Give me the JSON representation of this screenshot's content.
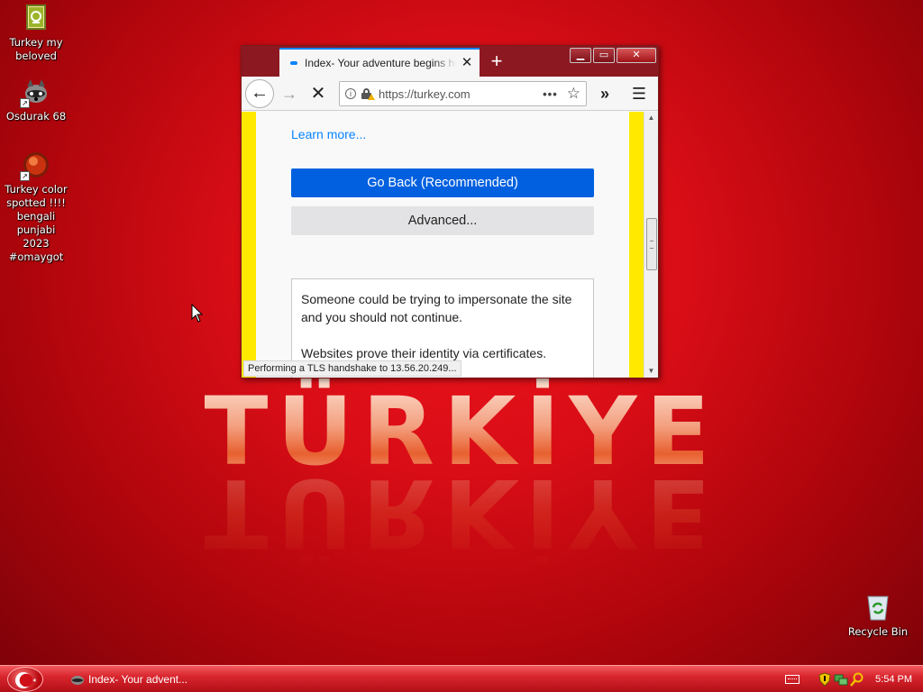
{
  "desktop": {
    "icons": [
      {
        "label": "Turkey my beloved",
        "icon": "document-icon"
      },
      {
        "label": "Osdurak 68",
        "icon": "raccoon-icon"
      },
      {
        "label": "Turkey color spotted !!!! bengali punjabi 2023 #omaygot",
        "icon": "red-ball-icon"
      },
      {
        "label": "Recycle Bin",
        "icon": "recycle-bin-icon"
      }
    ],
    "wallpaper_text": "TÜRKİYE"
  },
  "browser": {
    "tab_title": "Index- Your adventure begins here",
    "new_tab": "+",
    "window_buttons": {
      "minimize": "▁",
      "maximize": "▭",
      "close": "✕"
    },
    "url": "https://turkey.com",
    "page_actions": "•••",
    "content": {
      "learn_more": "Learn more...",
      "go_back": "Go Back (Recommended)",
      "advanced": "Advanced...",
      "details_p1": "Someone could be trying to impersonate the site and you should not continue.",
      "details_p2": "Websites prove their identity via certificates."
    },
    "status": "Performing a TLS handshake to 13.56.20.249..."
  },
  "taskbar": {
    "task_label": "Index- Your advent...",
    "clock": "5:54 PM"
  },
  "colors": {
    "accent_blue": "#0060df",
    "warning_yellow": "#ffe900",
    "titlebar": "#8c1821",
    "desktop_red": "#d80d16"
  }
}
